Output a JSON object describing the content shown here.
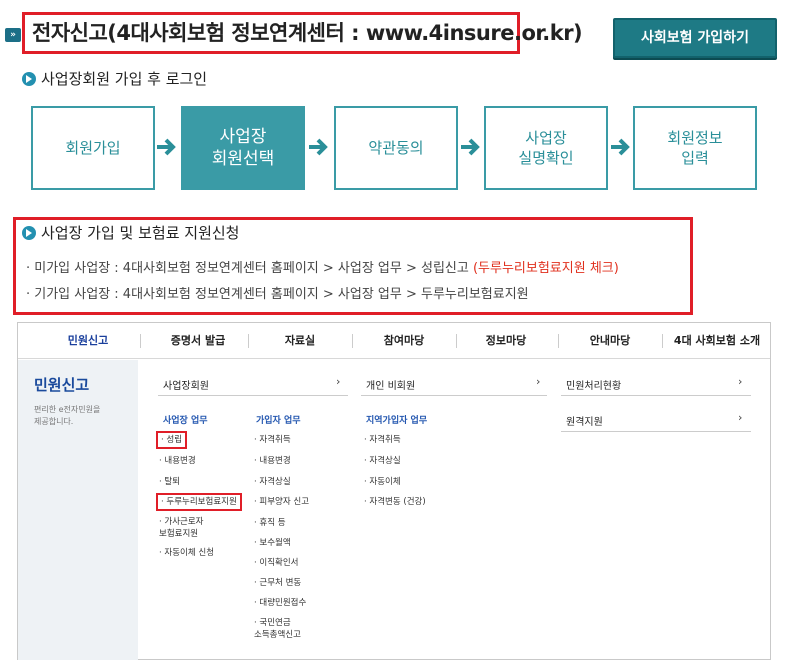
{
  "header": {
    "title": "전자신고(4대사회보험 정보연계센터 : www.4insure.or.kr)",
    "title_icon": "»",
    "join_button": "사회보험 가입하기"
  },
  "login_section": {
    "heading": "사업장회원 가입 후 로그인",
    "steps": [
      {
        "label": "회원가입",
        "active": false
      },
      {
        "label": "사업장\n회원선택",
        "active": true
      },
      {
        "label": "약관동의",
        "active": false
      },
      {
        "label": "사업장\n실명확인",
        "active": false
      },
      {
        "label": "회원정보\n입력",
        "active": false
      }
    ]
  },
  "support_section": {
    "heading": "사업장 가입 및 보험료 지원신청",
    "lines": [
      {
        "text": "· 미가입 사업장 : 4대사회보험 정보연계센터 홈페이지 > 사업장 업무 > 성립신고 ",
        "highlight": "(두루누리보험료지원 체크)"
      },
      {
        "text": "· 기가입 사업장 : 4대사회보험 정보연계센터 홈페이지 > 사업장 업무 > 두루누리보험료지원",
        "highlight": ""
      }
    ]
  },
  "portal": {
    "nav": [
      "민원신고",
      "증명서 발급",
      "자료실",
      "참여마당",
      "정보마당",
      "안내마당",
      "4대 사회보험 소개"
    ],
    "side_title": "민원신고",
    "side_desc": "편리한 e전자민원을\n제공합니다.",
    "columns": {
      "business_member": "사업장회원",
      "individual_member": "개인 비회원",
      "status": "민원처리현황",
      "remote": "원격지원",
      "chevron": "›"
    },
    "business_tasks": {
      "heading": "사업장 업무",
      "items": [
        "· 성립",
        "· 내용변경",
        "· 탈퇴",
        "· 두루누리보험료지원",
        "· 가사근로자\n  보험료지원",
        "· 자동이체 신청"
      ]
    },
    "subscriber_tasks": {
      "heading": "가입자 업무",
      "items": [
        "· 자격취득",
        "· 내용변경",
        "· 자격상실",
        "· 피부양자 신고",
        "· 휴직 등",
        "· 보수월액",
        "· 이직확인서",
        "· 근무처 변동",
        "· 대량민원접수",
        "· 국민연금\n  소득총액신고"
      ]
    },
    "regional_tasks": {
      "heading": "지역가입자 업무",
      "items": [
        "· 자격취득",
        "· 자격상실",
        "· 자동이체",
        "· 자격변동 (건강)"
      ]
    }
  },
  "colors": {
    "accent": "#3a9ba6",
    "highlight_border": "#e01e28",
    "button": "#1e7a85",
    "link_blue": "#2457b0"
  }
}
